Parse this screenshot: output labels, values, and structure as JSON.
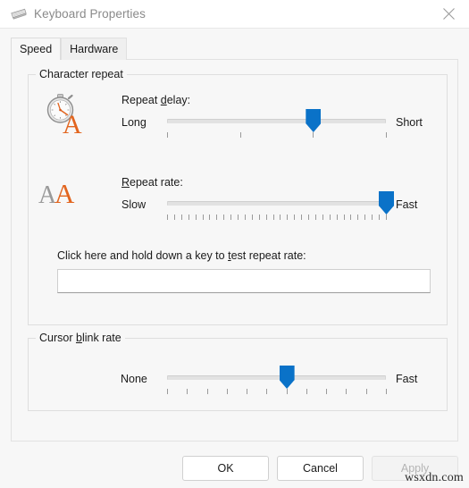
{
  "window": {
    "title": "Keyboard Properties",
    "icon": "keyboard-icon",
    "close_label": "×"
  },
  "tabs": [
    {
      "label": "Speed",
      "active": true
    },
    {
      "label": "Hardware",
      "active": false
    }
  ],
  "groups": {
    "character_repeat": {
      "title": "Character repeat",
      "repeat_delay": {
        "icon": "stopwatch-letter-a-icon",
        "label_prefix": "Repeat ",
        "label_accel": "d",
        "label_suffix": "elay:",
        "label_full": "Repeat delay:",
        "min_label": "Long",
        "max_label": "Short",
        "ticks": 4,
        "value": 2,
        "min": 0,
        "max": 3
      },
      "repeat_rate": {
        "icon": "double-letter-a-icon",
        "label_prefix": "",
        "label_accel": "R",
        "label_suffix": "epeat rate:",
        "label_full": "Repeat rate:",
        "min_label": "Slow",
        "max_label": "Fast",
        "ticks": 32,
        "value": 31,
        "min": 0,
        "max": 31
      },
      "test_field": {
        "label_prefix": "Click here and hold down a key to ",
        "label_accel": "t",
        "label_suffix": "est repeat rate:",
        "label_full": "Click here and hold down a key to test repeat rate:",
        "value": "",
        "placeholder": ""
      }
    },
    "cursor_blink": {
      "title_prefix": "Cursor ",
      "title_accel": "b",
      "title_suffix": "link rate",
      "title_full": "Cursor blink rate",
      "slider": {
        "min_label": "None",
        "max_label": "Fast",
        "ticks": 12,
        "value": 6,
        "min": 0,
        "max": 11
      }
    }
  },
  "footer": {
    "ok_label": "OK",
    "cancel_label": "Cancel",
    "apply_label": "Apply",
    "apply_disabled": true
  },
  "watermark": {
    "text": "wsxdn.com"
  },
  "colors": {
    "accent_blue": "#0a72c8",
    "icon_orange": "#e2651f",
    "icon_grey": "#9a9a9a",
    "window_bg": "#f7f7f7",
    "title_text": "#8a8a8a"
  }
}
